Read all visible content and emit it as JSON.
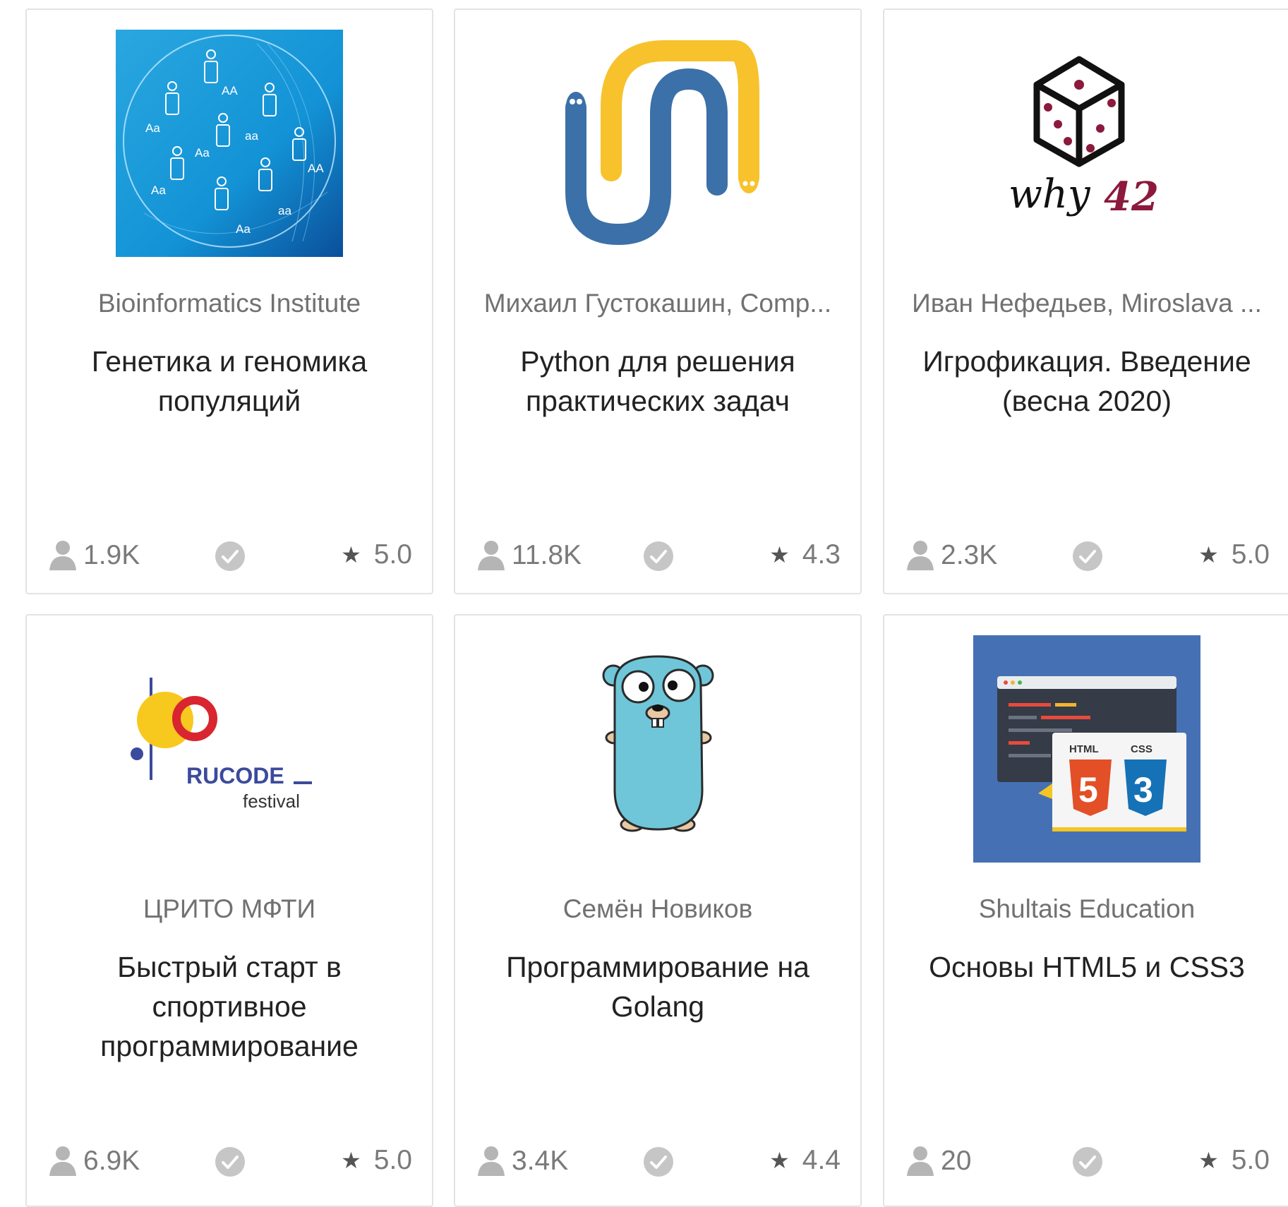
{
  "courses": [
    {
      "authors": "Bioinformatics Institute",
      "title": "Генетика и геномика популяций",
      "learners": "1.9K",
      "rating": "5.0",
      "cover_icon": "population-genetics-cover",
      "cover_labels": [
        "AA",
        "Aa",
        "aa",
        "Aa",
        "AA",
        "Aa",
        "aa",
        "Aa"
      ]
    },
    {
      "authors": "Михаил Густокашин,  Comp...",
      "title": "Python для решения практических задач",
      "learners": "11.8K",
      "rating": "4.3",
      "cover_icon": "python-snakes-cover"
    },
    {
      "authors": "Иван Нефедьев,  Miroslava ...",
      "title": "Игрофикация. Введение (весна 2020)",
      "learners": "2.3K",
      "rating": "5.0",
      "cover_icon": "dice-cover",
      "cover_text": "why",
      "cover_number": "42"
    },
    {
      "authors": "ЦРИТО МФТИ",
      "title": "Быстрый старт в спортивное программирование",
      "learners": "6.9K",
      "rating": "5.0",
      "cover_icon": "rucode-logo",
      "cover_text": "RUCODE",
      "cover_sub": "festival"
    },
    {
      "authors": "Семён Новиков",
      "title": "Программирование на Golang",
      "learners": "3.4K",
      "rating": "4.4",
      "cover_icon": "go-gopher-cover"
    },
    {
      "authors": "Shultais Education",
      "title": "Основы HTML5 и CSS3",
      "learners": "20",
      "rating": "5.0",
      "cover_icon": "html-css-cover",
      "cover_html": "HTML",
      "cover_css": "CSS"
    }
  ],
  "icons": {
    "learners": "user-icon",
    "certificate": "check-circle-icon",
    "rating": "star-icon"
  },
  "star_glyph": "★",
  "colors": {
    "card_border": "#e3e3e3",
    "meta_text": "#717171",
    "title_text": "#222222",
    "check_icon": "#c6c6c6"
  }
}
